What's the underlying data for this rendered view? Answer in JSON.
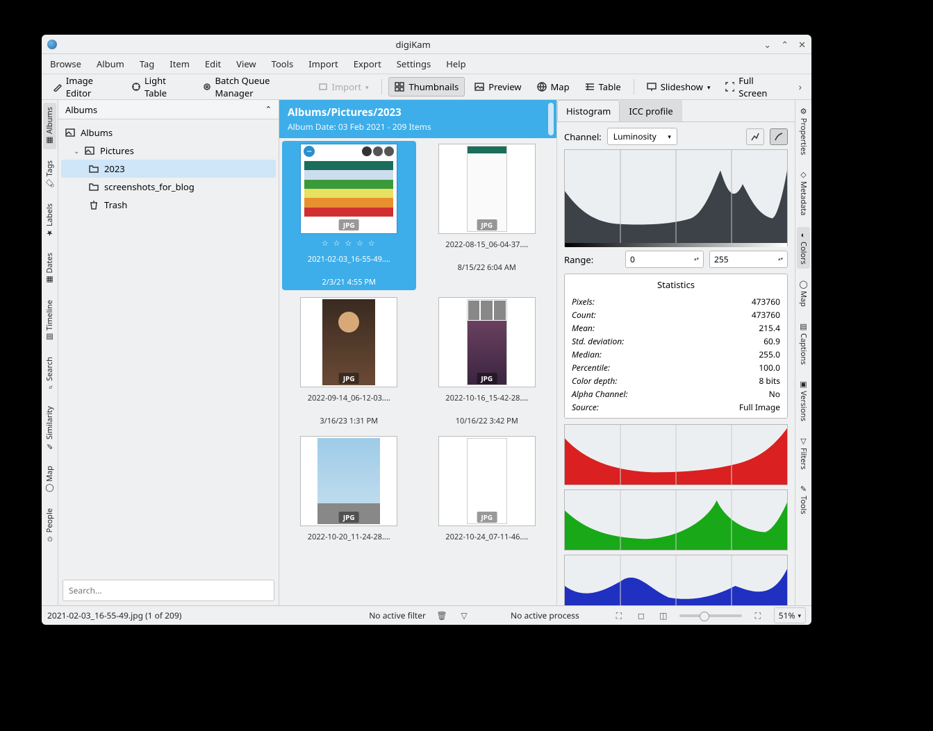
{
  "app_title": "digiKam",
  "menu": [
    "Browse",
    "Album",
    "Tag",
    "Item",
    "Edit",
    "View",
    "Tools",
    "Import",
    "Export",
    "Settings",
    "Help"
  ],
  "toolbar": {
    "image_editor": "Image Editor",
    "light_table": "Light Table",
    "batch_queue": "Batch Queue Manager",
    "import": "Import",
    "thumbnails": "Thumbnails",
    "preview": "Preview",
    "map": "Map",
    "table": "Table",
    "slideshow": "Slideshow",
    "fullscreen": "Full Screen"
  },
  "left_tabs": [
    "Albums",
    "Tags",
    "Labels",
    "Dates",
    "Timeline",
    "Search",
    "Similarity",
    "Map",
    "People"
  ],
  "left_tabs_active": "Albums",
  "right_tabs": [
    "Properties",
    "Metadata",
    "Colors",
    "Map",
    "Captions",
    "Versions",
    "Filters",
    "Tools"
  ],
  "right_tabs_active": "Colors",
  "left_panel": {
    "header": "Albums",
    "tree": {
      "root": "Albums",
      "pictures": "Pictures",
      "y2023": "2023",
      "screenshots": "screenshots_for_blog",
      "trash": "Trash"
    },
    "search_placeholder": "Search..."
  },
  "album_header": {
    "path": "Albums/Pictures/2023",
    "subtitle": "Album Date: 03 Feb 2021 - 209 Items"
  },
  "thumbs": [
    {
      "name": "2021-02-03_16-55-49....",
      "date": "2/3/21 4:55 PM",
      "fmt": "JPG",
      "sel": true,
      "kind": "table"
    },
    {
      "name": "2022-08-15_06-04-37....",
      "date": "8/15/22 6:04 AM",
      "fmt": "JPG",
      "kind": "phone"
    },
    {
      "name": "2022-09-14_06-12-03....",
      "date": "3/16/23 1:31 PM",
      "fmt": "JPG",
      "kind": "person"
    },
    {
      "name": "2022-10-16_15-42-28....",
      "date": "10/16/22 3:42 PM",
      "fmt": "JPG",
      "kind": "social"
    },
    {
      "name": "2022-10-20_11-24-28....",
      "date": "",
      "fmt": "JPG",
      "kind": "tree"
    },
    {
      "name": "2022-10-24_07-11-46....",
      "date": "",
      "fmt": "JPG",
      "kind": "list"
    }
  ],
  "right_panel": {
    "tabs": {
      "histogram": "Histogram",
      "icc": "ICC profile"
    },
    "channel_label": "Channel:",
    "channel_value": "Luminosity",
    "range_label": "Range:",
    "range_min": "0",
    "range_max": "255",
    "stats_header": "Statistics",
    "stats": [
      {
        "k": "Pixels:",
        "v": "473760"
      },
      {
        "k": "Count:",
        "v": "473760"
      },
      {
        "k": "Mean:",
        "v": "215.4"
      },
      {
        "k": "Std. deviation:",
        "v": "60.9"
      },
      {
        "k": "Median:",
        "v": "255.0"
      },
      {
        "k": "Percentile:",
        "v": "100.0"
      },
      {
        "k": "Color depth:",
        "v": "8 bits"
      },
      {
        "k": "Alpha Channel:",
        "v": "No"
      },
      {
        "k": "Source:",
        "v": "Full Image"
      }
    ]
  },
  "status": {
    "file": "2021-02-03_16-55-49.jpg (1 of 209)",
    "filter": "No active filter",
    "process": "No active process",
    "zoom": "51%"
  }
}
